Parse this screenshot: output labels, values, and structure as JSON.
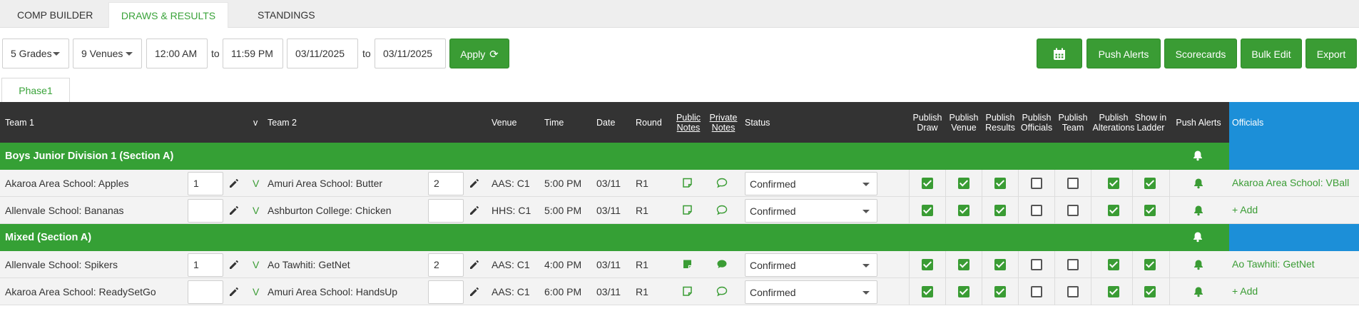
{
  "nav": {
    "tabs": [
      {
        "label": "COMP BUILDER"
      },
      {
        "label": "DRAWS & RESULTS"
      },
      {
        "label": "STANDINGS"
      }
    ]
  },
  "filters": {
    "grades": "5 Grades",
    "venues": "9 Venues",
    "time_from": "12:00 AM",
    "to1": "to",
    "time_to": "11:59 PM",
    "date_from": "03/11/2025",
    "to2": "to",
    "date_to": "03/11/2025",
    "apply_label": "Apply",
    "refresh_glyph": "⟳"
  },
  "actions": {
    "push_alerts": "Push Alerts",
    "scorecards": "Scorecards",
    "bulk_edit": "Bulk Edit",
    "export": "Export",
    "calendar_icon": "calendar-icon"
  },
  "phase_tab": "Phase1",
  "table": {
    "headers": {
      "team1": "Team 1",
      "v": "v",
      "team2": "Team 2",
      "venue": "Venue",
      "time": "Time",
      "date": "Date",
      "round": "Round",
      "public_notes": [
        "Public",
        "Notes"
      ],
      "private_notes": [
        "Private",
        "Notes"
      ],
      "status": "Status",
      "publish_draw": [
        "Publish",
        "Draw"
      ],
      "publish_venue": [
        "Publish",
        "Venue"
      ],
      "publish_results": [
        "Publish",
        "Results"
      ],
      "publish_officials": [
        "Publish",
        "Officials"
      ],
      "publish_team": [
        "Publish",
        "Team"
      ],
      "publish_alterations": [
        "Publish",
        "Alterations"
      ],
      "show_in_ladder": [
        "Show in",
        "Ladder"
      ],
      "push_alerts": "Push Alerts",
      "officials": "Officials"
    },
    "groups": [
      {
        "title": "Boys Junior Division 1 (Section A)",
        "rows": [
          {
            "team1": "Akaroa Area School: Apples",
            "score1": "1",
            "v": "V",
            "team2": "Amuri Area School: Butter",
            "score2": "2",
            "venue": "AAS: C1",
            "time": "5:00 PM",
            "date": "03/11",
            "round": "R1",
            "status": "Confirmed",
            "notes_filled": false,
            "checks": [
              true,
              true,
              true,
              false,
              false,
              true,
              true
            ],
            "official": "Akaroa Area School: VBall"
          },
          {
            "team1": "Allenvale School: Bananas",
            "score1": "",
            "v": "V",
            "team2": "Ashburton College: Chicken",
            "score2": "",
            "venue": "HHS: C1",
            "time": "5:00 PM",
            "date": "03/11",
            "round": "R1",
            "status": "Confirmed",
            "notes_filled": false,
            "checks": [
              true,
              true,
              true,
              false,
              false,
              true,
              true
            ],
            "official": "+ Add"
          }
        ]
      },
      {
        "title": "Mixed (Section A)",
        "rows": [
          {
            "team1": "Allenvale School: Spikers",
            "score1": "1",
            "v": "V",
            "team2": "Ao Tawhiti: GetNet",
            "score2": "2",
            "venue": "AAS: C1",
            "time": "4:00 PM",
            "date": "03/11",
            "round": "R1",
            "status": "Confirmed",
            "notes_filled": true,
            "checks": [
              true,
              true,
              true,
              false,
              false,
              true,
              true
            ],
            "official": "Ao Tawhiti: GetNet"
          },
          {
            "team1": "Akaroa Area School: ReadySetGo",
            "score1": "",
            "v": "V",
            "team2": "Amuri Area School: HandsUp",
            "score2": "",
            "venue": "AAS: C1",
            "time": "6:00 PM",
            "date": "03/11",
            "round": "R1",
            "status": "Confirmed",
            "notes_filled": false,
            "checks": [
              true,
              true,
              true,
              false,
              false,
              true,
              true
            ],
            "official": "+ Add"
          }
        ]
      }
    ]
  },
  "colors": {
    "accent_green": "#3a9c34",
    "header_dark": "#333333",
    "officials_blue": "#1c8fd8"
  }
}
